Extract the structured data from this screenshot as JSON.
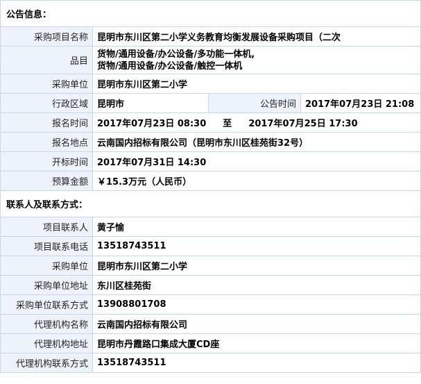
{
  "announcement": {
    "section_title": "公告信息：",
    "rows": [
      {
        "label": "采购项目名称",
        "value": "昆明市东川区第二小学义务教育均衡发展设备采购项目（二次"
      },
      {
        "label": "品目",
        "value_lines": [
          "货物/通用设备/办公设备/多功能一体机,",
          "货物/通用设备/办公设备/触控一体机"
        ]
      },
      {
        "label": "采购单位",
        "value": "昆明市东川区第二小学"
      },
      {
        "label": "行政区域",
        "value": "昆明市",
        "label2": "公告时间",
        "value2": "2017年07月23日 21:08"
      },
      {
        "label": "报名时间",
        "from": "2017年07月23日 08:30",
        "to_label": "至",
        "to": "2017年07月25日 17:30"
      },
      {
        "label": "报名地点",
        "value": "云南国内招标有限公司（昆明市东川区桂苑街32号）"
      },
      {
        "label": "开标时间",
        "value": "2017年07月31日 14:30"
      },
      {
        "label": "预算金额",
        "value": "￥15.3万元（人民币）"
      }
    ]
  },
  "contacts": {
    "section_title": "联系人及联系方式：",
    "rows": [
      {
        "label": "项目联系人",
        "value": "黄子愉"
      },
      {
        "label": "项目联系电话",
        "value": "13518743511"
      },
      {
        "label": "采购单位",
        "value": "昆明市东川区第二小学"
      },
      {
        "label": "采购单位地址",
        "value": "东川区桂苑街"
      },
      {
        "label": "采购单位联系方式",
        "value": "13908801708"
      },
      {
        "label": "代理机构名称",
        "value": "云南国内招标有限公司"
      },
      {
        "label": "代理机构地址",
        "value": "昆明市丹霞路口集成大厦CD座"
      },
      {
        "label": "代理机构联系方式",
        "value": "13518743511"
      }
    ]
  }
}
